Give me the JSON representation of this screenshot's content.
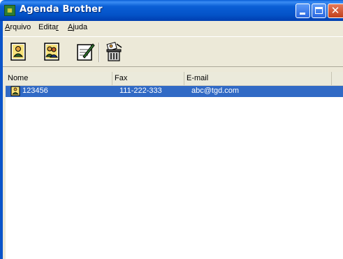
{
  "window": {
    "title": "Agenda Brother",
    "app_icon": "address-book-icon"
  },
  "menu": {
    "items": [
      {
        "label": "Arquivo",
        "accel": "A",
        "rest": "rquivo"
      },
      {
        "label": "Editar",
        "accel": "r",
        "pre": "Edita"
      },
      {
        "label": "Ajuda",
        "accel": "A",
        "rest": "juda"
      }
    ]
  },
  "toolbar": {
    "buttons": [
      {
        "name": "new-member-button",
        "icon": "person-card-icon"
      },
      {
        "name": "new-group-button",
        "icon": "group-card-icon"
      },
      {
        "name": "edit-button",
        "icon": "edit-pencil-icon"
      },
      {
        "name": "delete-button",
        "icon": "trash-icon"
      }
    ]
  },
  "list": {
    "columns": [
      "Nome",
      "Fax",
      "E-mail"
    ],
    "rows": [
      {
        "nome": "123456",
        "fax": "111-222-333",
        "email": "abc@tgd.com",
        "selected": true
      }
    ]
  },
  "colors": {
    "title_bar": "#0a54c9",
    "selection": "#316ac5",
    "window_face": "#ece9d8"
  }
}
